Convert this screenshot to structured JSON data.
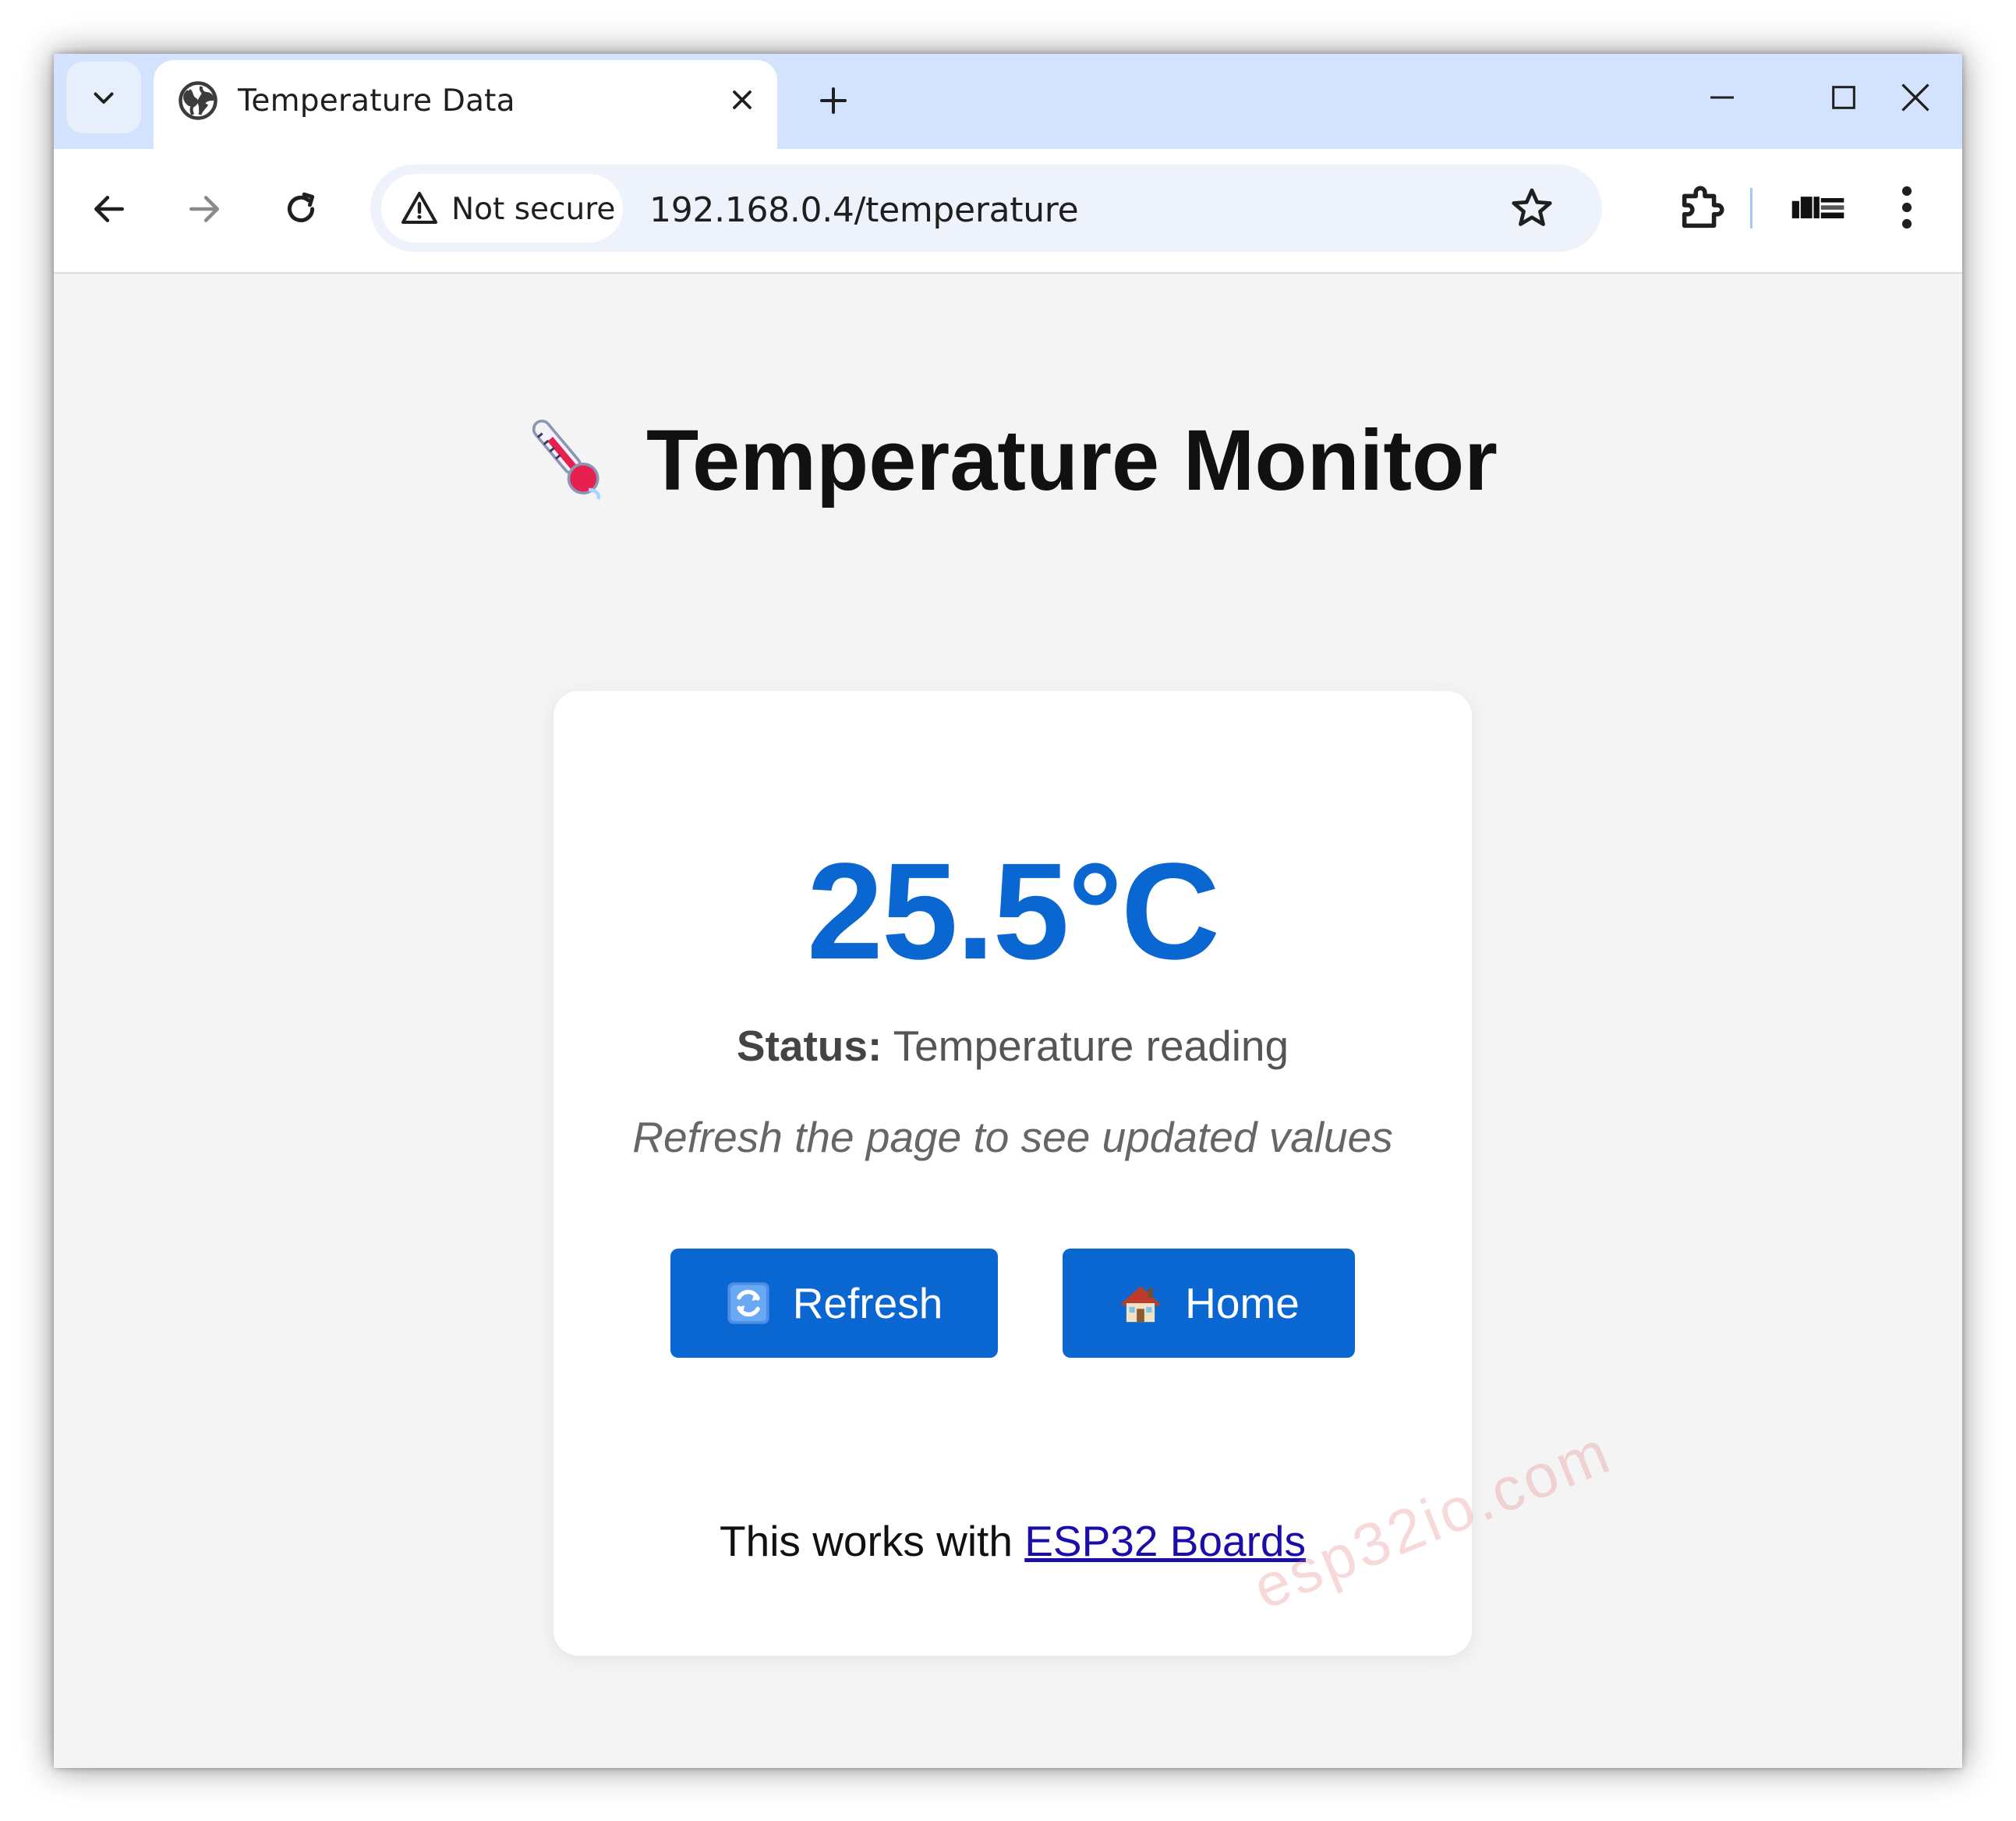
{
  "browser": {
    "tab_title": "Temperature Data",
    "security_label": "Not secure",
    "url": "192.168.0.4/temperature"
  },
  "page": {
    "heading": "Temperature Monitor",
    "temperature": "25.5°C",
    "status_label": "Status:",
    "status_value": "Temperature reading",
    "hint": "Refresh the page to see updated values",
    "refresh_label": "Refresh",
    "home_label": "Home",
    "footer_prefix": "This works with",
    "footer_link": "ESP32 Boards"
  },
  "watermark": "esp32io.com",
  "colors": {
    "accent": "#0a66d1",
    "tabbar": "#d3e3fd",
    "link": "#1a0dab"
  },
  "icons": {
    "heading": "thermometer-icon",
    "refresh": "refresh-icon",
    "home": "house-icon"
  }
}
